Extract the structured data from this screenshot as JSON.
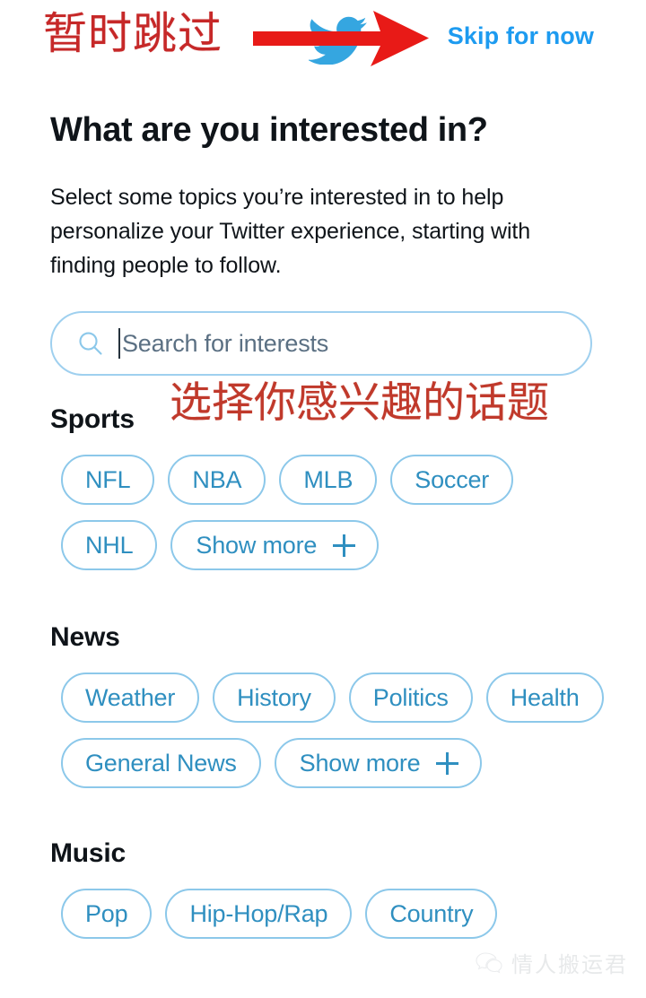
{
  "annotations": {
    "skip_cn": "暂时跳过",
    "topics_cn": "选择你感兴趣的话题",
    "arrow_icon": "red-right-arrow-icon",
    "bird_icon": "twitter-bird-icon"
  },
  "header": {
    "skip_label": "Skip for now",
    "accent_color": "#1d9bf0"
  },
  "main": {
    "title": "What are you interested in?",
    "description": "Select some topics you’re interested in to help personalize your Twitter experience, starting with finding people to follow."
  },
  "search": {
    "icon": "search-icon",
    "placeholder": "Search for interests",
    "value": ""
  },
  "sections": [
    {
      "id": "sports",
      "title": "Sports",
      "chips": [
        {
          "label": "NFL",
          "more": false
        },
        {
          "label": "NBA",
          "more": false
        },
        {
          "label": "MLB",
          "more": false
        },
        {
          "label": "Soccer",
          "more": false
        },
        {
          "label": "NHL",
          "more": false
        },
        {
          "label": "Show more",
          "more": true
        }
      ]
    },
    {
      "id": "news",
      "title": "News",
      "chips": [
        {
          "label": "Weather",
          "more": false
        },
        {
          "label": "History",
          "more": false
        },
        {
          "label": "Politics",
          "more": false
        },
        {
          "label": "Health",
          "more": false
        },
        {
          "label": "General News",
          "more": false
        },
        {
          "label": "Show more",
          "more": true
        }
      ]
    },
    {
      "id": "music",
      "title": "Music",
      "chips": [
        {
          "label": "Pop",
          "more": false
        },
        {
          "label": "Hip-Hop/Rap",
          "more": false
        },
        {
          "label": "Country",
          "more": false
        }
      ]
    }
  ],
  "watermark": {
    "icon": "wechat-icon",
    "text": "情人搬运君"
  },
  "colors": {
    "chip_border": "#8cc8ea",
    "chip_text": "#2f8fc0",
    "annotation_red": "#c0392b",
    "text_primary": "#0f1419"
  }
}
